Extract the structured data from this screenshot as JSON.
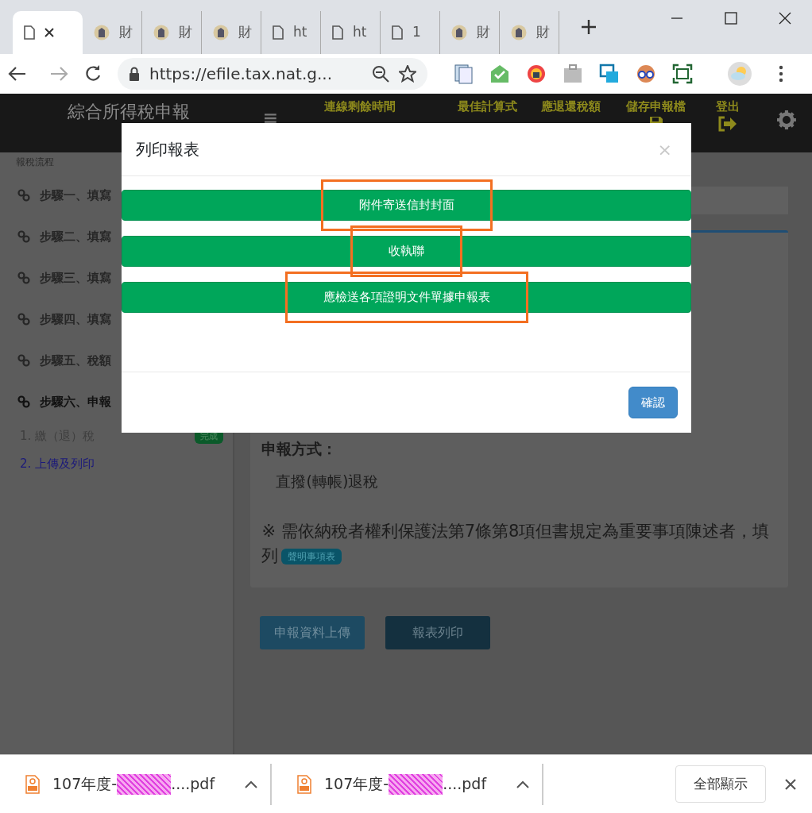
{
  "browser": {
    "tabs": [
      {
        "kind": "page",
        "selected": true
      },
      {
        "label": "財",
        "kind": "emblem",
        "selected": false
      },
      {
        "label": "財",
        "kind": "emblem",
        "selected": false
      },
      {
        "label": "財",
        "kind": "emblem",
        "selected": false
      },
      {
        "label": "ht",
        "kind": "page",
        "selected": false
      },
      {
        "label": "ht",
        "kind": "page",
        "selected": false
      },
      {
        "label": "1",
        "kind": "page",
        "selected": false
      },
      {
        "label": "財",
        "kind": "emblem",
        "selected": false
      },
      {
        "label": "財",
        "kind": "emblem",
        "selected": false
      }
    ],
    "address": "https://efile.tax.nat.g..."
  },
  "header": {
    "title": "綜合所得稅申報",
    "columns": [
      {
        "label": "連線剩餘時間",
        "kind": "text"
      },
      {
        "label": "最佳計算式",
        "kind": "text"
      },
      {
        "label": "應退還稅額",
        "kind": "text"
      },
      {
        "label": "儲存申報檔",
        "kind": "save"
      },
      {
        "label": "登出",
        "kind": "logout"
      }
    ]
  },
  "sidebar": {
    "heading": "報稅流程",
    "steps": [
      {
        "label": "步驟一、填寫",
        "selected": false
      },
      {
        "label": "步驟二、填寫",
        "selected": false
      },
      {
        "label": "步驟三、填寫",
        "selected": false
      },
      {
        "label": "步驟四、填寫",
        "selected": false
      },
      {
        "label": "步驟五、稅額",
        "selected": false
      },
      {
        "label": "步驟六、申報",
        "selected": true
      }
    ],
    "substeps": [
      {
        "label": "1. 繳（退）稅",
        "badge": "完成",
        "selected": false
      },
      {
        "label": "2. 上傳及列印",
        "selected": true
      }
    ]
  },
  "main": {
    "method_label": "申報方式：",
    "method_value": "直撥(轉帳)退稅",
    "note": "※ 需依納稅者權利保護法第7條第8項但書規定為重要事項陳述者，填列",
    "note_badge": "聲明事項表",
    "buttons": [
      "申報資料上傳",
      "報表列印"
    ]
  },
  "modal": {
    "title": "列印報表",
    "close": "×",
    "options": [
      {
        "label": "附件寄送信封封面",
        "highlighted": true
      },
      {
        "label": "收執聯",
        "highlighted": true
      },
      {
        "label": "應檢送各項證明文件單據申報表",
        "highlighted": true
      }
    ],
    "confirm": "確認"
  },
  "downloads": {
    "items": [
      {
        "prefix": "107年度-",
        "redacted": true,
        "suffix": "....pdf"
      },
      {
        "prefix": "107年度-",
        "redacted": true,
        "suffix": "....pdf"
      }
    ],
    "show_all": "全部顯示"
  }
}
